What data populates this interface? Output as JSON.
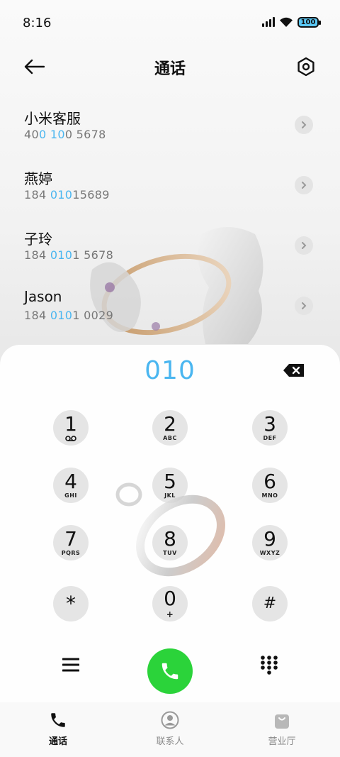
{
  "status_bar": {
    "time": "8:16",
    "battery": "100"
  },
  "header": {
    "title": "通话"
  },
  "contacts": [
    {
      "name": "小米客服",
      "number_parts": [
        "40",
        "0",
        " ",
        "10",
        "0 5678"
      ]
    },
    {
      "name": "燕婷",
      "number_parts": [
        "184 ",
        "010",
        "15689",
        "",
        ""
      ]
    },
    {
      "name": "子玲",
      "number_parts": [
        "184 ",
        "010",
        "1 5678",
        "",
        ""
      ]
    },
    {
      "name": "Jason",
      "number_parts": [
        "184 ",
        "010",
        "1 0029",
        "",
        ""
      ]
    }
  ],
  "dialer": {
    "input": "010",
    "keys": [
      {
        "digit": "1",
        "letters": ""
      },
      {
        "digit": "2",
        "letters": "ABC"
      },
      {
        "digit": "3",
        "letters": "DEF"
      },
      {
        "digit": "4",
        "letters": "GHI"
      },
      {
        "digit": "5",
        "letters": "JKL"
      },
      {
        "digit": "6",
        "letters": "MNO"
      },
      {
        "digit": "7",
        "letters": "PQRS"
      },
      {
        "digit": "8",
        "letters": "TUV"
      },
      {
        "digit": "9",
        "letters": "WXYZ"
      },
      {
        "digit": "*",
        "letters": ""
      },
      {
        "digit": "0",
        "letters": "+"
      },
      {
        "digit": "#",
        "letters": ""
      }
    ]
  },
  "bottom_nav": {
    "tabs": [
      {
        "label": "通话",
        "icon": "phone-icon"
      },
      {
        "label": "联系人",
        "icon": "person-icon"
      },
      {
        "label": "营业厅",
        "icon": "shopping-bag-icon"
      }
    ]
  },
  "colors": {
    "accent": "#4ab6f0",
    "call": "#2bd33a"
  }
}
